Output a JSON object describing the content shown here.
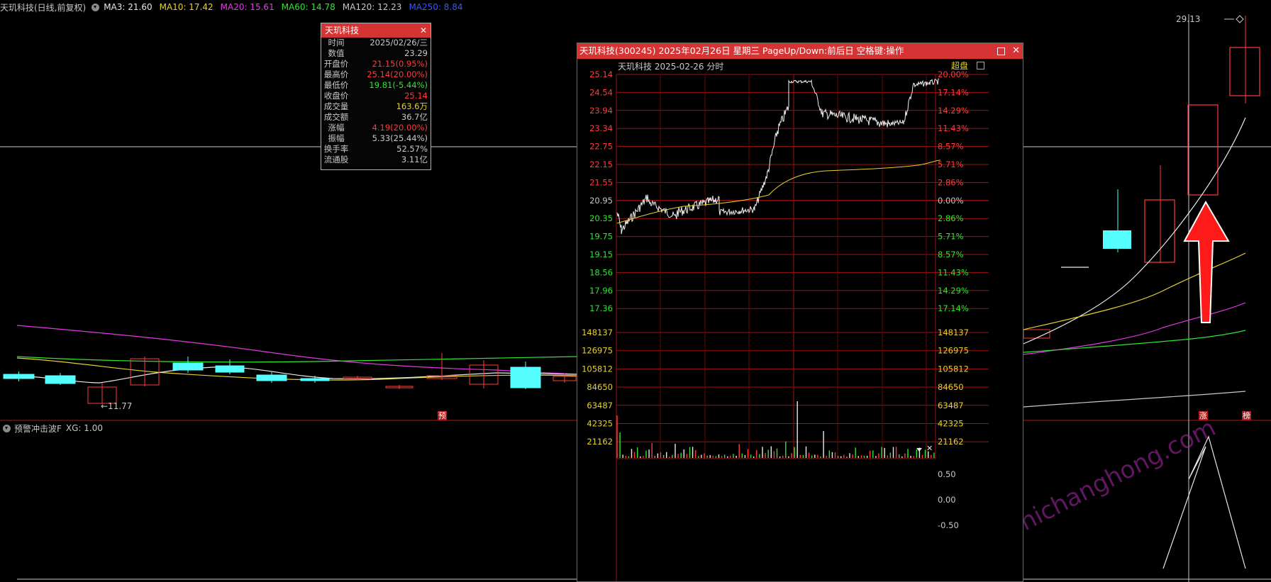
{
  "main": {
    "title": "天玑科技(日线,前复权)",
    "ma": [
      {
        "label": "MA3: 21.60",
        "color": "#e8e8e8"
      },
      {
        "label": "MA10: 17.42",
        "color": "#e6d22a"
      },
      {
        "label": "MA20: 15.61",
        "color": "#e637e6"
      },
      {
        "label": "MA60: 14.78",
        "color": "#2ee62e"
      },
      {
        "label": "MA120: 12.23",
        "color": "#c8c8c8"
      },
      {
        "label": "MA250: 8.84",
        "color": "#3a56ff"
      }
    ],
    "low_marker": "←11.77",
    "high_marker": "29.13",
    "yu_badge": "预",
    "zhang_badge": "涨",
    "bang_badge": "榜"
  },
  "indicator": {
    "label": "预警冲击波F",
    "xg": "XG: 1.00"
  },
  "info_popup": {
    "title": "天玑科技",
    "rows": [
      {
        "k": "时间",
        "v": "2025/02/26/三",
        "color": "#c8c8c8"
      },
      {
        "k": "数值",
        "v": "23.29",
        "color": "#c8c8c8"
      },
      {
        "k": "开盘价",
        "v": "21.15(0.95%)",
        "color": "#ff3b3b"
      },
      {
        "k": "最高价",
        "v": "25.14(20.00%)",
        "color": "#ff3b3b"
      },
      {
        "k": "最低价",
        "v": "19.81(-5.44%)",
        "color": "#2ee62e"
      },
      {
        "k": "收盘价",
        "v": "25.14",
        "color": "#ff3b3b"
      },
      {
        "k": "成交量",
        "v": "163.6万",
        "color": "#e6d22a"
      },
      {
        "k": "成交额",
        "v": "36.7亿",
        "color": "#c8c8c8"
      },
      {
        "k": "涨幅",
        "v": "4.19(20.00%)",
        "color": "#ff3b3b"
      },
      {
        "k": "振幅",
        "v": "5.33(25.44%)",
        "color": "#c8c8c8"
      },
      {
        "k": "换手率",
        "v": "52.57%",
        "color": "#c8c8c8"
      },
      {
        "k": "流通股",
        "v": "3.11亿",
        "color": "#c8c8c8"
      }
    ]
  },
  "intraday": {
    "title": "天玑科技(300245)  2025年02月26日  星期三  PageUp/Down:前后日  空格键:操作",
    "subtitle": "天玑科技  2025-02-26 分时",
    "chaopan": "超盘",
    "price_ticks": [
      "25.14",
      "24.54",
      "23.94",
      "23.34",
      "22.75",
      "22.15",
      "21.55",
      "20.95",
      "20.35",
      "19.75",
      "19.15",
      "18.56",
      "17.96",
      "17.36"
    ],
    "pct_ticks": [
      "20.00%",
      "17.14%",
      "14.29%",
      "11.43%",
      "8.57%",
      "5.71%",
      "2.86%",
      "0.00%",
      "2.86%",
      "5.71%",
      "8.57%",
      "11.43%",
      "14.29%",
      "17.14%"
    ],
    "vol_ticks": [
      "148137",
      "126975",
      "105812",
      "84650",
      "63487",
      "42325",
      "21162"
    ],
    "ind_ticks": [
      "0.50",
      "0.00",
      "-0.50"
    ]
  },
  "watermark": "www.gushichanghong.com",
  "colors": {
    "up": "#ff3b3b",
    "down": "#2ee62e",
    "flat": "#c8c8c8",
    "grid": "#a01010"
  }
}
